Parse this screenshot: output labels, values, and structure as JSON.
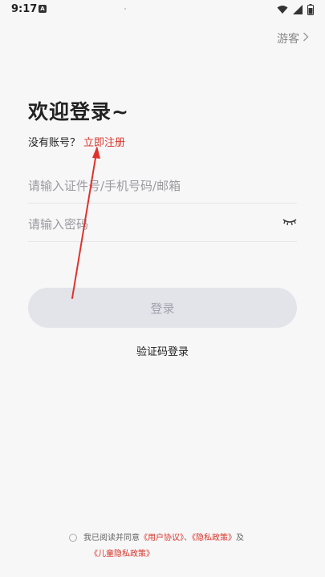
{
  "status_bar": {
    "time": "9:17",
    "notif_letter": "A"
  },
  "header": {
    "guest_label": "游客",
    "guest_chevron": "›"
  },
  "login": {
    "title": "欢迎登录~",
    "no_account": "没有账号？",
    "register_now": "立即注册",
    "account_placeholder": "请输入证件号/手机号码/邮箱",
    "password_placeholder": "请输入密码",
    "login_button": "登录",
    "code_login": "验证码登录"
  },
  "agreement": {
    "prefix": "我已阅读并同意",
    "user_agreement": "《用户协议》",
    "separator": "、",
    "privacy_policy": "《隐私政策》",
    "and": "及",
    "children_privacy": "《儿童隐私政策》"
  },
  "colors": {
    "accent": "#d8362b",
    "button_bg": "#e3e3ea",
    "annotation_arrow": "#e0322c"
  },
  "icons": [
    "wifi-icon",
    "cellular-signal-icon",
    "battery-icon",
    "eye-closed-icon",
    "chevron-right-icon"
  ]
}
